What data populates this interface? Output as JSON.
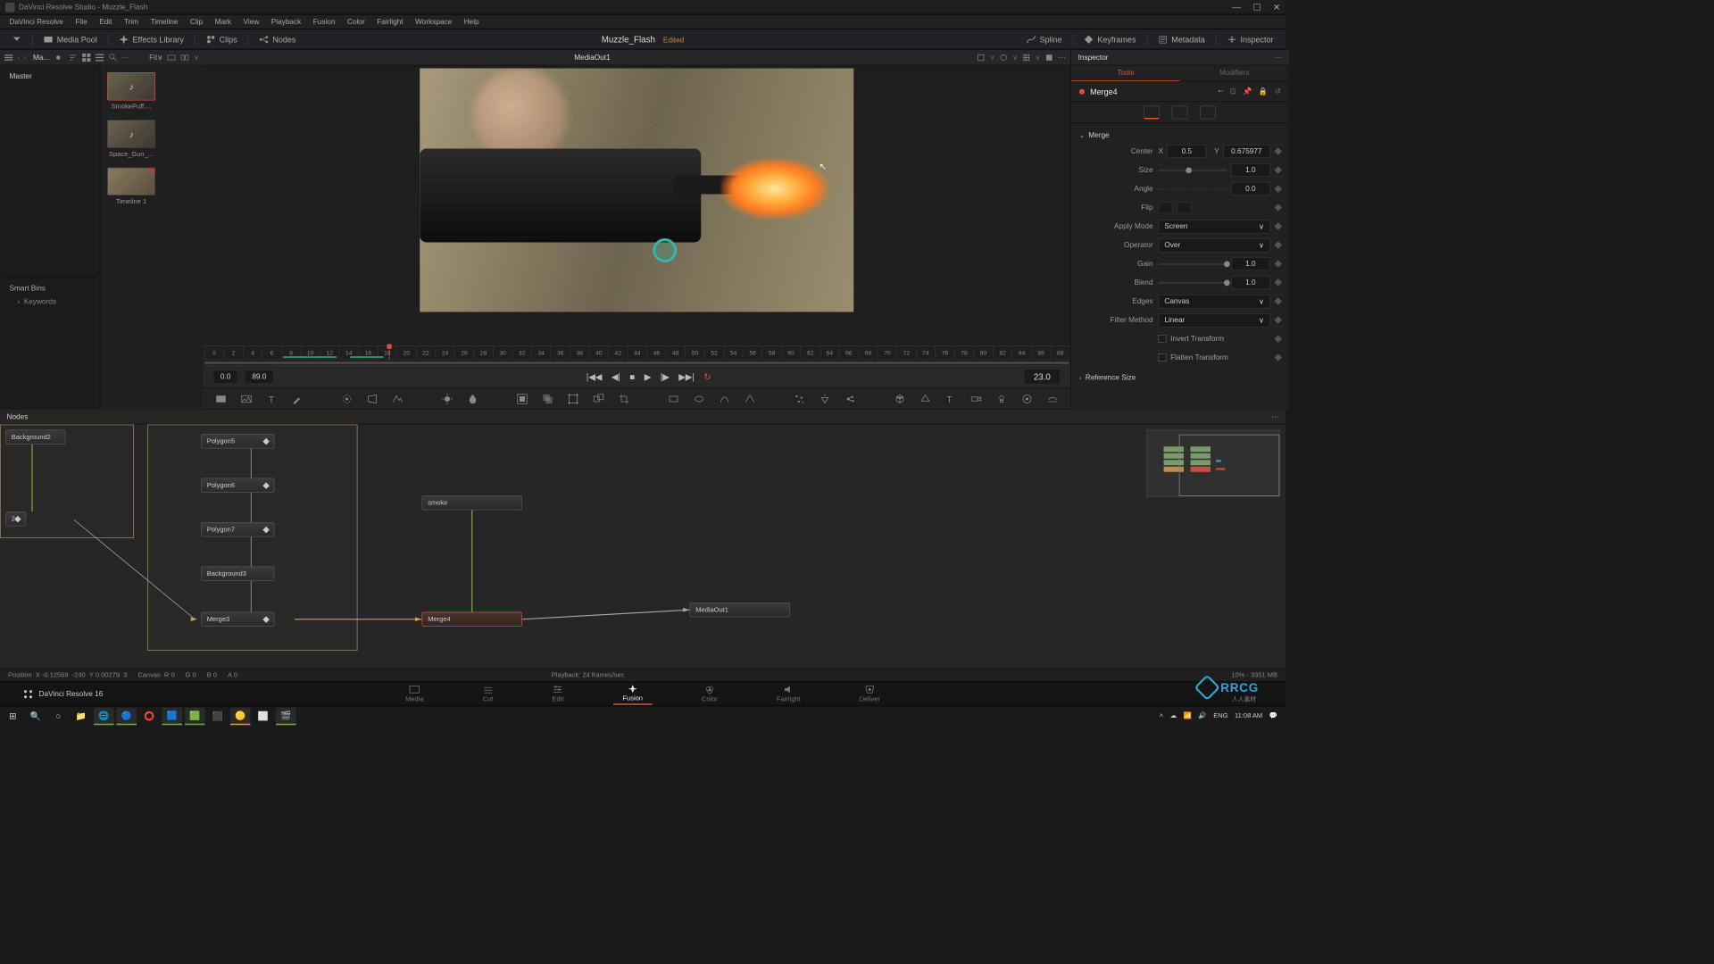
{
  "titlebar": {
    "text": "DaVinci Resolve Studio - Muzzle_Flash"
  },
  "menubar": [
    "DaVinci Resolve",
    "File",
    "Edit",
    "Trim",
    "Timeline",
    "Clip",
    "Mark",
    "View",
    "Playback",
    "Fusion",
    "Color",
    "Fairlight",
    "Workspace",
    "Help"
  ],
  "topToolbar": {
    "mediaPool": "Media Pool",
    "effectsLib": "Effects Library",
    "clips": "Clips",
    "nodes": "Nodes",
    "spline": "Spline",
    "keyframes": "Keyframes",
    "metadata": "Metadata",
    "inspector": "Inspector"
  },
  "project": {
    "name": "Muzzle_Flash",
    "status": "Edited"
  },
  "mediaHeader": {
    "binLabel": "Ma...",
    "fit": "Fit∨"
  },
  "master": "Master",
  "clips": [
    {
      "label": "SmokePuff....",
      "selected": true,
      "audio": true
    },
    {
      "label": "Space_Gun_...",
      "selected": false,
      "audio": true
    },
    {
      "label": "Timeline 1",
      "selected": false,
      "corner": true
    }
  ],
  "smartBins": {
    "title": "Smart Bins",
    "items": [
      "Keywords"
    ]
  },
  "viewer": {
    "title": "MediaOut1",
    "ruler": [
      "0",
      "2",
      "4",
      "6",
      "8",
      "10",
      "12",
      "14",
      "16",
      "18",
      "20",
      "22",
      "24",
      "26",
      "28",
      "30",
      "32",
      "34",
      "36",
      "38",
      "40",
      "42",
      "44",
      "46",
      "48",
      "50",
      "52",
      "54",
      "56",
      "58",
      "60",
      "62",
      "64",
      "66",
      "68",
      "70",
      "72",
      "74",
      "76",
      "78",
      "80",
      "82",
      "84",
      "86",
      "88"
    ],
    "startTC": "0.0",
    "endTC": "89.0",
    "currentTC": "23.0"
  },
  "inspector": {
    "title": "Inspector",
    "tabs": {
      "tools": "Tools",
      "modifiers": "Modifiers"
    },
    "nodeName": "Merge4",
    "sections": {
      "merge": "Merge",
      "refSize": "Reference Size"
    },
    "params": {
      "center": "Center",
      "centerX": "X",
      "centerXVal": "0.5",
      "centerY": "Y",
      "centerYVal": "0.675977",
      "size": "Size",
      "sizeVal": "1.0",
      "angle": "Angle",
      "angleVal": "0.0",
      "flip": "Flip",
      "applyMode": "Apply Mode",
      "applyModeVal": "Screen",
      "operator": "Operator",
      "operatorVal": "Over",
      "gain": "Gain",
      "gainVal": "1.0",
      "blend": "Blend",
      "blendVal": "1.0",
      "edges": "Edges",
      "edgesVal": "Canvas",
      "filter": "Filter Method",
      "filterVal": "Linear",
      "invert": "Invert Transform",
      "flatten": "Flatten Transform"
    }
  },
  "nodes": {
    "title": "Nodes",
    "list": {
      "background2": "Background2",
      "polygon5": "Polygon5",
      "polygon6": "Polygon6",
      "polygon7": "Polygon7",
      "background3": "Background3",
      "merge3": "Merge3",
      "smoke": "smoke",
      "merge4": "Merge4",
      "mediaOut1": "MediaOut1"
    }
  },
  "status": {
    "position": "Position",
    "x": "X",
    "xVal": "-0.12569",
    "xPix": "-240",
    "y": "Y",
    "yVal": "0.00279",
    "yPix": "3",
    "canvas": "Canvas",
    "r": "R",
    "rVal": "0",
    "g": "G",
    "gVal": "0",
    "b": "B",
    "bVal": "0",
    "a": "A",
    "aVal": "0",
    "playback": "Playback: 24 frames/sec",
    "zoom": "10% - 3351 MB"
  },
  "pages": {
    "media": "Media",
    "cut": "Cut",
    "edit": "Edit",
    "fusion": "Fusion",
    "color": "Color",
    "fairlight": "Fairlight",
    "deliver": "Deliver",
    "home": "DaVinci Resolve 16"
  },
  "tray": {
    "lang": "ENG",
    "time": "11:08 AM"
  },
  "watermark": {
    "brand": "RRCG",
    "sub": "人人素材"
  }
}
